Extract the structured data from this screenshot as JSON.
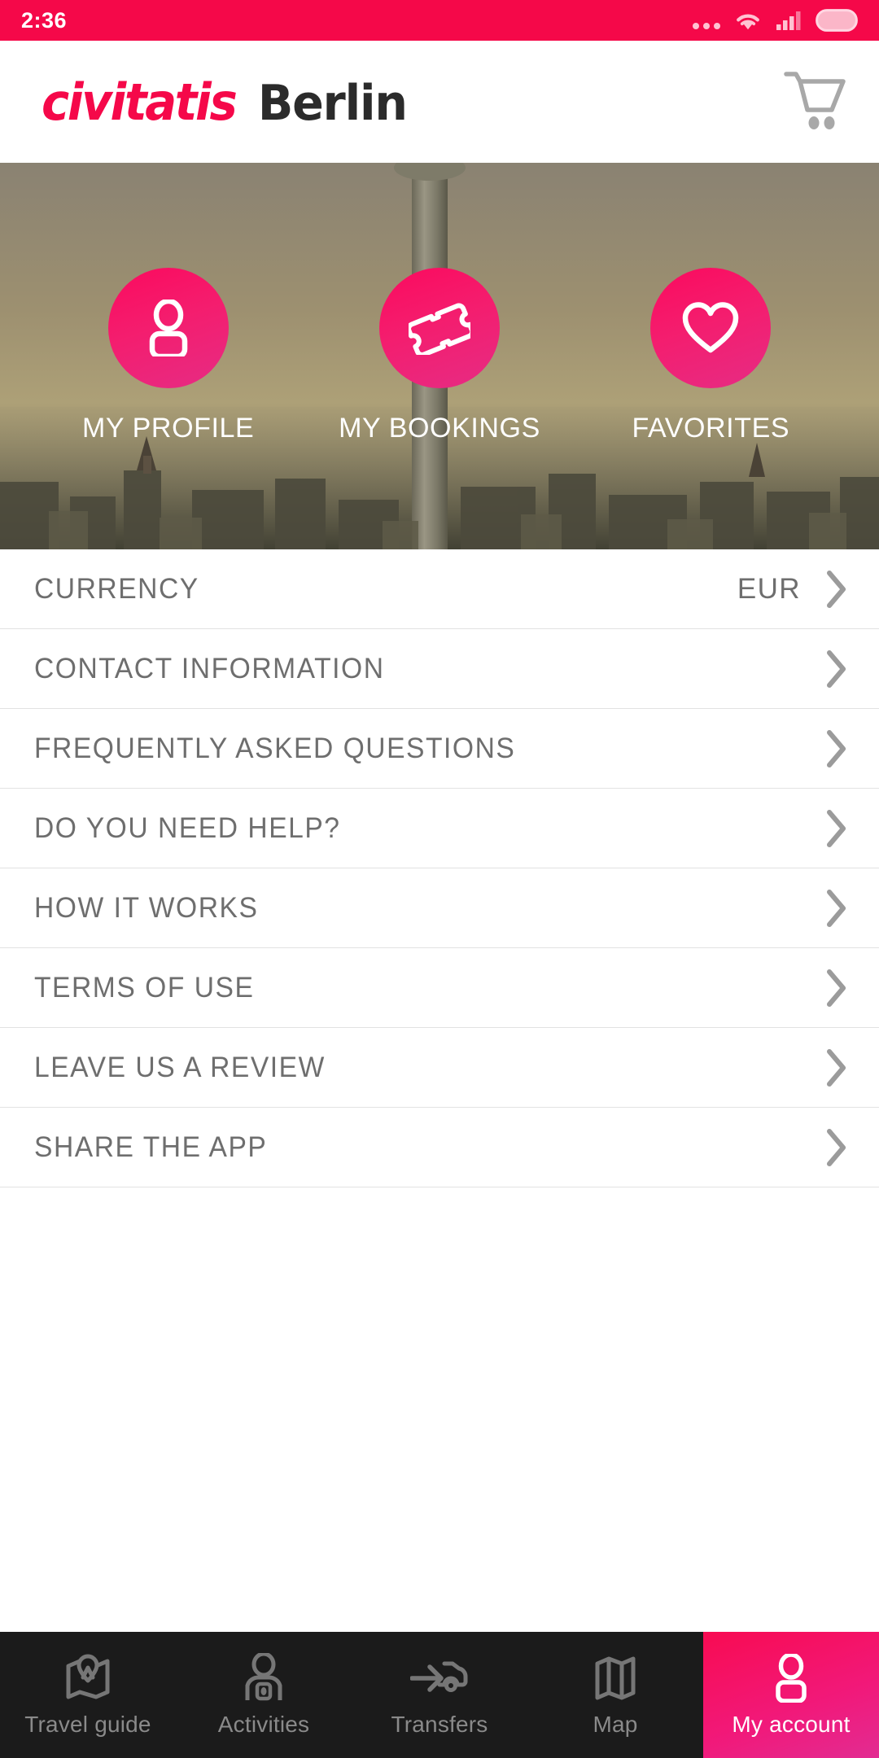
{
  "statusbar": {
    "time": "2:36",
    "icons": [
      "more-dots-icon",
      "wifi-icon",
      "cellular-signal-icon",
      "battery-icon"
    ]
  },
  "header": {
    "brand": "civitatis",
    "city": "Berlin",
    "cart_icon": "shopping-cart-icon",
    "brand_color": "#F50849",
    "city_color": "#2B2B2B"
  },
  "hero": {
    "image_description": "Berlin TV Tower (Fernsehturm) above city skyline at dusk",
    "actions": [
      {
        "label": "MY PROFILE",
        "icon": "person-icon"
      },
      {
        "label": "MY BOOKINGS",
        "icon": "ticket-icon"
      },
      {
        "label": "FAVORITES",
        "icon": "heart-icon"
      }
    ],
    "circle_color": "#FB0A5E"
  },
  "menu": {
    "rows": [
      {
        "label": "CURRENCY",
        "value": "EUR",
        "chevron": "chevron-right-icon"
      },
      {
        "label": "CONTACT INFORMATION",
        "value": "",
        "chevron": "chevron-right-icon"
      },
      {
        "label": "FREQUENTLY ASKED QUESTIONS",
        "value": "",
        "chevron": "chevron-right-icon"
      },
      {
        "label": "DO YOU NEED HELP?",
        "value": "",
        "chevron": "chevron-right-icon"
      },
      {
        "label": "HOW IT WORKS",
        "value": "",
        "chevron": "chevron-right-icon"
      },
      {
        "label": "TERMS OF USE",
        "value": "",
        "chevron": "chevron-right-icon"
      },
      {
        "label": "LEAVE US A REVIEW",
        "value": "",
        "chevron": "chevron-right-icon"
      },
      {
        "label": "SHARE THE APP",
        "value": "",
        "chevron": "chevron-right-icon"
      }
    ]
  },
  "bottomnav": {
    "items": [
      {
        "label": "Travel guide",
        "icon": "map-pin-guide-icon",
        "active": false
      },
      {
        "label": "Activities",
        "icon": "person-activity-icon",
        "active": false
      },
      {
        "label": "Transfers",
        "icon": "car-transfer-icon",
        "active": false
      },
      {
        "label": "Map",
        "icon": "folded-map-icon",
        "active": false
      },
      {
        "label": "My account",
        "icon": "person-icon",
        "active": true
      }
    ],
    "active_color": "#F80B52",
    "background": "#1B1B1B"
  }
}
